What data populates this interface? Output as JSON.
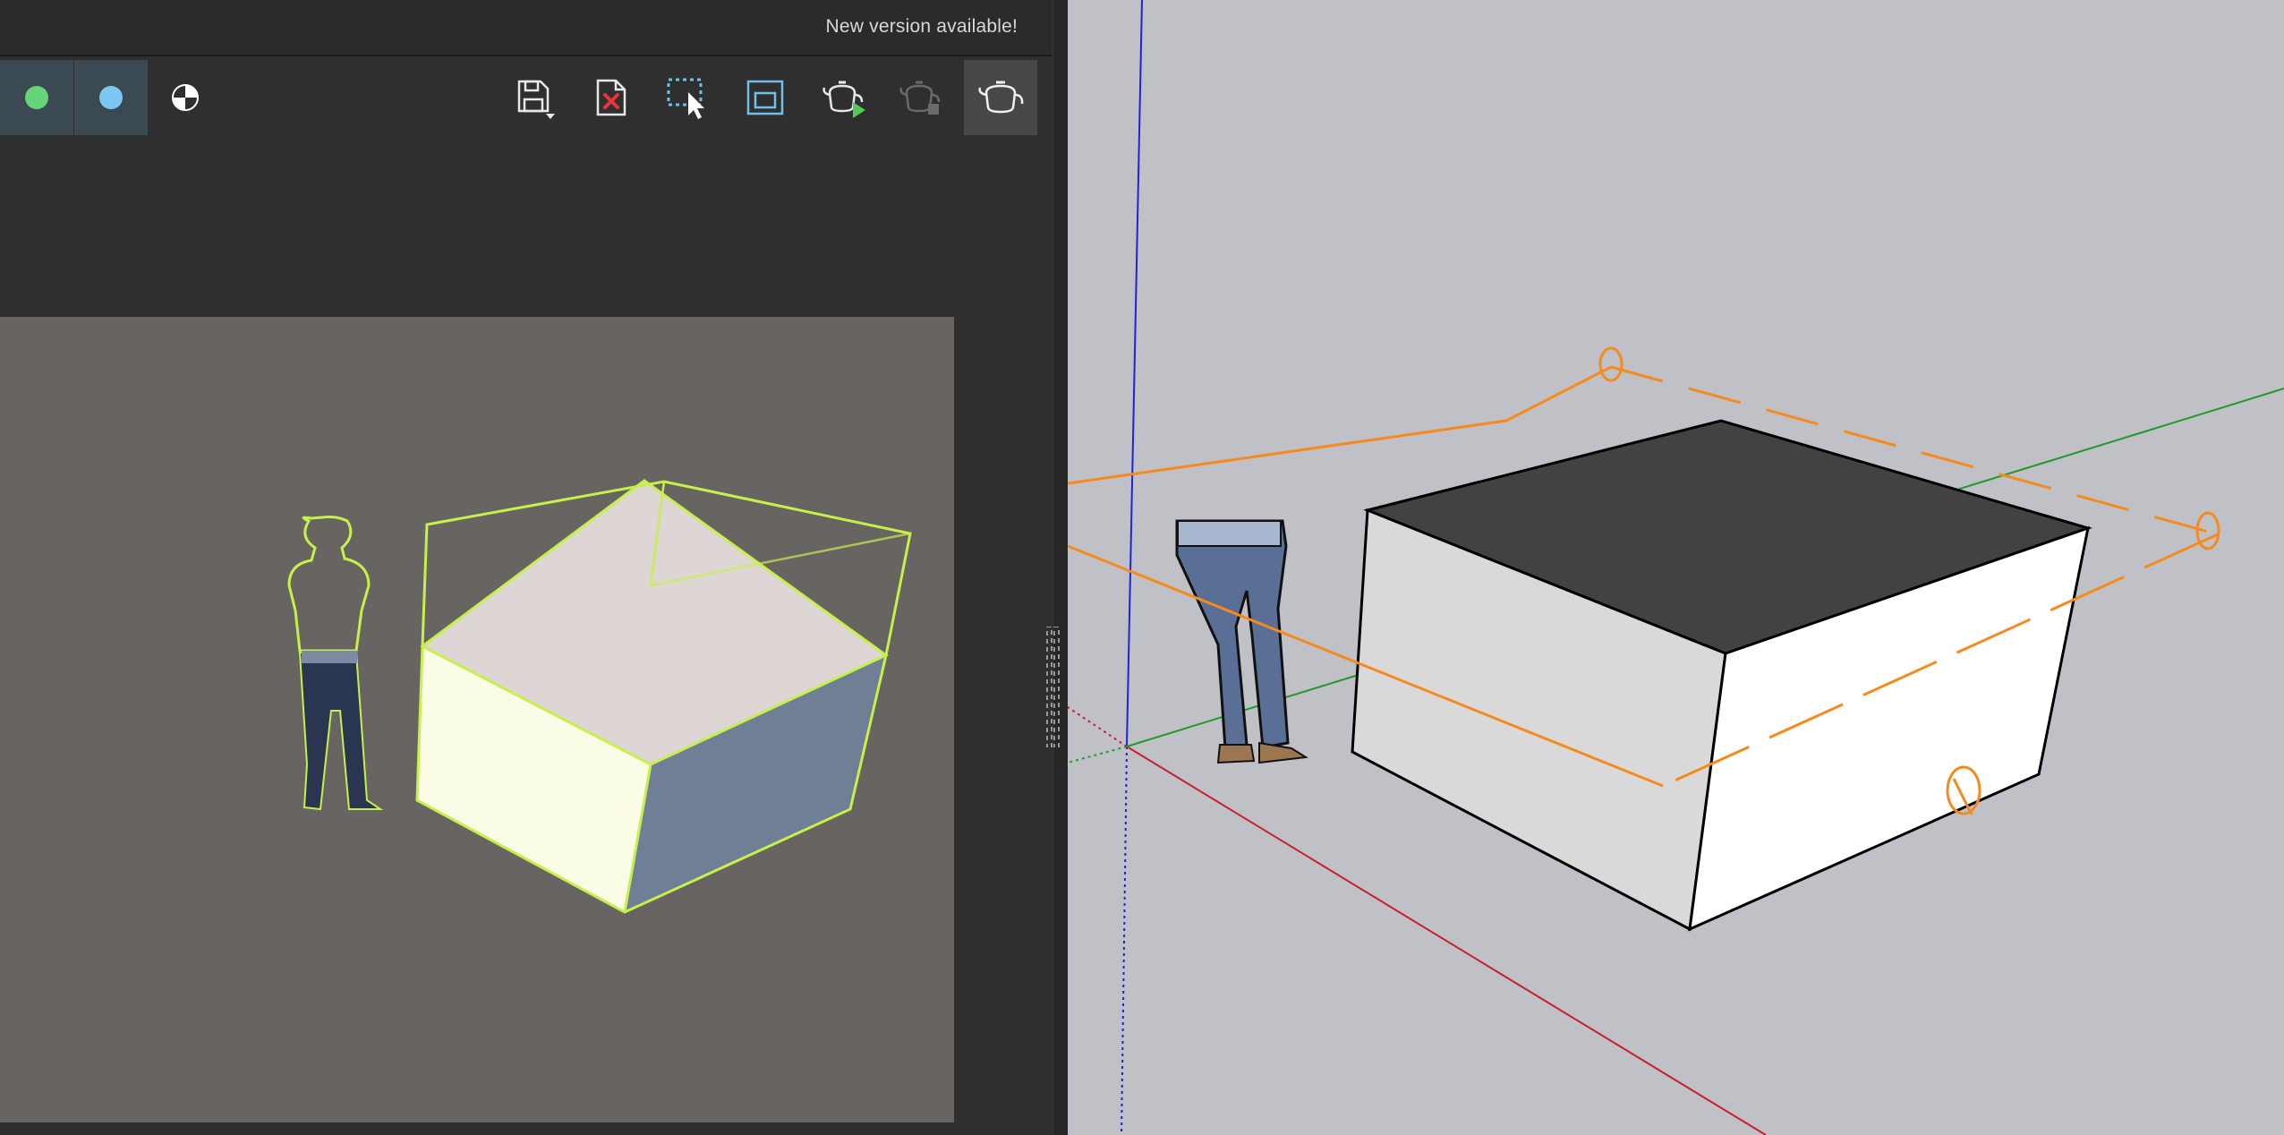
{
  "header": {
    "update_notice": "New version available!"
  },
  "toolbar": {
    "buttons": [
      {
        "name": "green-material-button",
        "icon": "green-sphere-icon",
        "color": "#67d47a"
      },
      {
        "name": "blue-material-button",
        "icon": "blue-sphere-icon",
        "color": "#7cc8f2"
      },
      {
        "name": "material-preview-button",
        "icon": "checker-sphere-icon"
      },
      {
        "name": "save-button",
        "icon": "save-icon"
      },
      {
        "name": "clear-button",
        "icon": "clear-icon"
      },
      {
        "name": "select-region-button",
        "icon": "select-region-icon"
      },
      {
        "name": "render-region-button",
        "icon": "render-region-icon"
      },
      {
        "name": "start-render-button",
        "icon": "teapot-play-icon"
      },
      {
        "name": "stop-render-button",
        "icon": "teapot-stop-icon"
      },
      {
        "name": "interactive-render-button",
        "icon": "teapot-icon"
      }
    ]
  },
  "colors": {
    "accent_orange": "#f58a1f",
    "outline_green": "#c6f04a",
    "axis_blue": "#1f24d8",
    "axis_red": "#c8202a",
    "axis_green": "#1f9a2a"
  }
}
